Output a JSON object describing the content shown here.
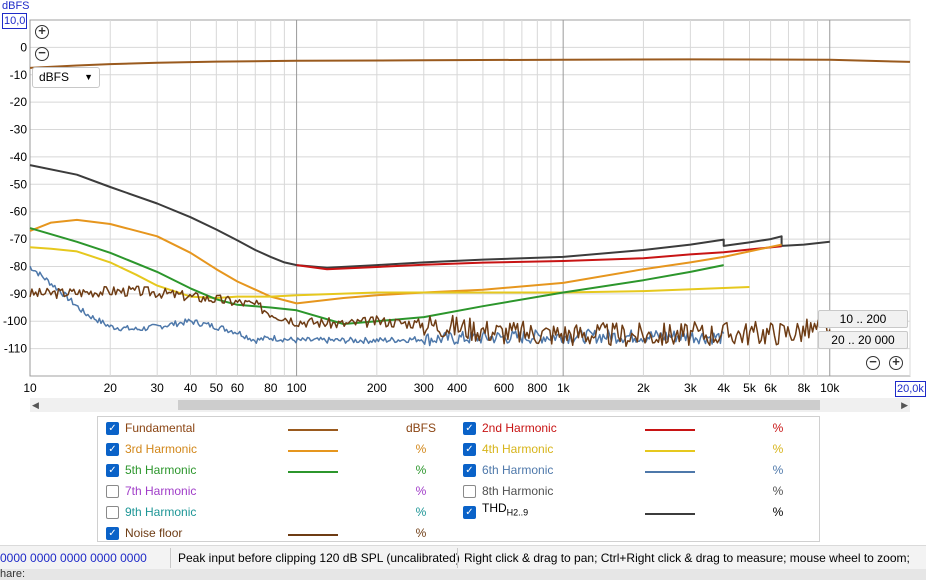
{
  "y_axis_corner": {
    "top_label": "10,0",
    "unit_label": "dBFS"
  },
  "x_axis_corner": {
    "right_label": "20,0k"
  },
  "unit_selector": {
    "value": "dBFS"
  },
  "range_buttons": {
    "narrow": "10 .. 200",
    "wide": "20 .. 20 000"
  },
  "legend": {
    "items": [
      {
        "name": "Fundamental",
        "checked": true,
        "color": "#9a5a1e",
        "unit": "dBFS",
        "label_color": "#8b4513",
        "unit_color": "#8b4513"
      },
      {
        "name": "2nd Harmonic",
        "checked": true,
        "color": "#c81414",
        "unit": "%",
        "label_color": "#c81414",
        "unit_color": "#c81414"
      },
      {
        "name": "3rd Harmonic",
        "checked": true,
        "color": "#e6961e",
        "unit": "%",
        "label_color": "#d2871a",
        "unit_color": "#d2871a"
      },
      {
        "name": "4th Harmonic",
        "checked": true,
        "color": "#e6c81e",
        "unit": "%",
        "label_color": "#d7b41a",
        "unit_color": "#d7b41a"
      },
      {
        "name": "5th Harmonic",
        "checked": true,
        "color": "#2c962c",
        "unit": "%",
        "label_color": "#2c962c",
        "unit_color": "#2c962c"
      },
      {
        "name": "6th Harmonic",
        "checked": true,
        "color": "#4e78aa",
        "unit": "%",
        "label_color": "#4e78aa",
        "unit_color": "#4e78aa"
      },
      {
        "name": "7th Harmonic",
        "checked": false,
        "color": "",
        "unit": "%",
        "label_color": "#a03cc8",
        "unit_color": "#a03cc8"
      },
      {
        "name": "8th Harmonic",
        "checked": false,
        "color": "",
        "unit": "%",
        "label_color": "#505050",
        "unit_color": "#505050"
      },
      {
        "name": "9th Harmonic",
        "checked": false,
        "color": "",
        "unit": "%",
        "label_color": "#1e9696",
        "unit_color": "#1e9696"
      },
      {
        "name": "THD",
        "sub": "H2..9",
        "checked": true,
        "color": "#3c3c3c",
        "unit": "%",
        "label_color": "#000000",
        "unit_color": "#000000"
      },
      {
        "name": "Noise floor",
        "checked": true,
        "color": "#6e3c14",
        "unit": "%",
        "label_color": "#6e3c14",
        "unit_color": "#6e3c14"
      }
    ]
  },
  "status_bar": {
    "values": "0000  0000 0000  0000 0000",
    "peak": "Peak input before clipping 120 dB SPL (uncalibrated)",
    "hint": "Right click & drag to pan; Ctrl+Right click & drag to measure; mouse wheel to zoom;"
  },
  "bottom_strip": {
    "text": "hare:"
  },
  "chart_data": {
    "type": "line",
    "xscale": "log",
    "xlim": [
      10,
      20000
    ],
    "ylim": [
      -120,
      10
    ],
    "ylabel": "dBFS",
    "yticks": [
      0,
      -10,
      -20,
      -30,
      -40,
      -50,
      -60,
      -70,
      -80,
      -90,
      -100,
      -110
    ],
    "xticks": [
      {
        "v": 10,
        "t": "10"
      },
      {
        "v": 20,
        "t": "20"
      },
      {
        "v": 30,
        "t": "30"
      },
      {
        "v": 40,
        "t": "40"
      },
      {
        "v": 50,
        "t": "50"
      },
      {
        "v": 60,
        "t": "60"
      },
      {
        "v": 80,
        "t": "80"
      },
      {
        "v": 100,
        "t": "100"
      },
      {
        "v": 200,
        "t": "200"
      },
      {
        "v": 300,
        "t": "300"
      },
      {
        "v": 400,
        "t": "400"
      },
      {
        "v": 600,
        "t": "600"
      },
      {
        "v": 800,
        "t": "800"
      },
      {
        "v": 1000,
        "t": "1k"
      },
      {
        "v": 2000,
        "t": "2k"
      },
      {
        "v": 3000,
        "t": "3k"
      },
      {
        "v": 4000,
        "t": "4k"
      },
      {
        "v": 5000,
        "t": "5k"
      },
      {
        "v": 6000,
        "t": "6k"
      },
      {
        "v": 8000,
        "t": "8k"
      },
      {
        "v": 10000,
        "t": "10k"
      }
    ],
    "series": [
      {
        "name": "Fundamental",
        "color": "#9a5a1e",
        "width": 2,
        "x": [
          10,
          15,
          20,
          30,
          50,
          100,
          300,
          1000,
          3000,
          10000,
          20000
        ],
        "y": [
          -7.5,
          -6.6,
          -6.1,
          -5.6,
          -5.2,
          -4.9,
          -4.7,
          -4.5,
          -4.4,
          -4.5,
          -5.3
        ]
      },
      {
        "name": "THD H2..9",
        "color": "#3c3c3c",
        "width": 2,
        "x": [
          10,
          15,
          20,
          30,
          40,
          50,
          60,
          70,
          80,
          90,
          100,
          130,
          200,
          300,
          500,
          1000,
          2000,
          3000,
          4000,
          4000,
          5000,
          6000,
          6600,
          6600,
          8000,
          10000
        ],
        "y": [
          -43,
          -46.5,
          -51,
          -57,
          -62,
          -66.5,
          -70.5,
          -74,
          -76.5,
          -78.5,
          -79.5,
          -80.5,
          -79.5,
          -78.5,
          -77.5,
          -76.5,
          -74,
          -72,
          -70.2,
          -72.5,
          -71.2,
          -70,
          -69,
          -72.5,
          -72,
          -71
        ]
      },
      {
        "name": "2nd Harmonic",
        "color": "#c81414",
        "width": 2,
        "x": [
          100,
          130,
          200,
          300,
          500,
          1000,
          2000,
          3000,
          4000,
          5000,
          6600
        ],
        "y": [
          -79.5,
          -81,
          -80.2,
          -79.4,
          -78.6,
          -78,
          -77,
          -75.6,
          -74.8,
          -73.8,
          -72.6
        ]
      },
      {
        "name": "3rd Harmonic",
        "color": "#e6961e",
        "width": 2,
        "x": [
          10,
          12,
          15,
          20,
          30,
          40,
          50,
          60,
          80,
          100,
          150,
          200,
          300,
          500,
          1000,
          2000,
          3000,
          4000,
          5000,
          6600
        ],
        "y": [
          -67,
          -64,
          -63,
          -64.5,
          -69,
          -75,
          -81,
          -85.5,
          -91,
          -93.5,
          -91.5,
          -90.5,
          -89.5,
          -88.5,
          -86,
          -81,
          -78.5,
          -76.5,
          -74.5,
          -72
        ]
      },
      {
        "name": "4th Harmonic",
        "color": "#e6c81e",
        "width": 2,
        "x": [
          10,
          12,
          15,
          20,
          25,
          30,
          40,
          50,
          60,
          80,
          100,
          200,
          400,
          1000,
          2000,
          5000
        ],
        "y": [
          -73,
          -73.5,
          -74.5,
          -78.5,
          -83,
          -87,
          -91,
          -91.5,
          -91,
          -91,
          -90.5,
          -89.5,
          -89.5,
          -89.5,
          -89,
          -87.5
        ]
      },
      {
        "name": "5th Harmonic",
        "color": "#2c962c",
        "width": 2,
        "x": [
          10,
          15,
          20,
          30,
          40,
          50,
          60,
          80,
          100,
          150,
          200,
          300,
          500,
          1000,
          2000,
          3000,
          4000
        ],
        "y": [
          -66,
          -71,
          -75,
          -82,
          -88,
          -92,
          -94,
          -95,
          -96,
          -101,
          -100,
          -98.5,
          -94.5,
          -89.5,
          -85,
          -82,
          -79.5
        ]
      },
      {
        "name": "6th Harmonic",
        "color": "#4e78aa",
        "width": 1.5,
        "noise": 1.6,
        "seed": 7,
        "x": [
          10,
          13,
          16,
          20,
          25,
          30,
          40,
          50,
          60,
          70,
          80,
          100,
          200,
          300,
          500,
          1000,
          2000,
          3000,
          4000
        ],
        "y": [
          -80,
          -89,
          -97,
          -102,
          -103,
          -102,
          -100,
          -102,
          -104,
          -107,
          -106,
          -107,
          -107,
          -106.5,
          -106,
          -105.5,
          -105.5,
          -105.5,
          -106
        ]
      },
      {
        "name": "Noise floor",
        "color": "#6e3c14",
        "width": 1.5,
        "noise": 2.8,
        "seed": 3,
        "x": [
          10,
          15,
          20,
          25,
          30,
          40,
          50,
          60,
          70,
          80,
          100,
          150,
          200,
          300,
          400,
          600,
          1000,
          2000,
          4000,
          7000,
          10000
        ],
        "y": [
          -90,
          -89.5,
          -89,
          -89,
          -89.5,
          -91,
          -92,
          -93,
          -94,
          -97,
          -100,
          -101,
          -100,
          -101,
          -102,
          -104,
          -104.5,
          -105,
          -104.5,
          -104,
          -102.5
        ]
      }
    ]
  }
}
